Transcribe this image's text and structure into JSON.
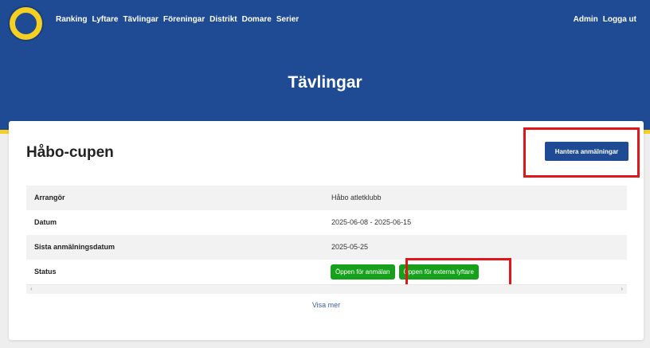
{
  "nav": {
    "items": [
      "Ranking",
      "Lyftare",
      "Tävlingar",
      "Föreningar",
      "Distrikt",
      "Domare",
      "Serier"
    ],
    "right": [
      "Admin",
      "Logga ut"
    ]
  },
  "page": {
    "title": "Tävlingar"
  },
  "competition": {
    "name": "Håbo-cupen",
    "manage_button": "Hantera anmälningar",
    "rows": [
      {
        "label": "Arrangör",
        "value": "Håbo atletklubb"
      },
      {
        "label": "Datum",
        "value": "2025-06-08 - 2025-06-15"
      },
      {
        "label": "Sista anmälningsdatum",
        "value": "2025-05-25"
      }
    ],
    "status": {
      "label": "Status",
      "badges": [
        "Öppen för anmälan",
        "Öppen för externa lyftare"
      ]
    },
    "scroll_left": "‹",
    "scroll_right": "›",
    "show_more": "Visa mer"
  },
  "colors": {
    "header": "#1e4b93",
    "accent": "#f6cf23",
    "badge": "#17a01b",
    "highlight": "#e0161b"
  },
  "icons": {
    "logo": "federation-logo-icon"
  }
}
